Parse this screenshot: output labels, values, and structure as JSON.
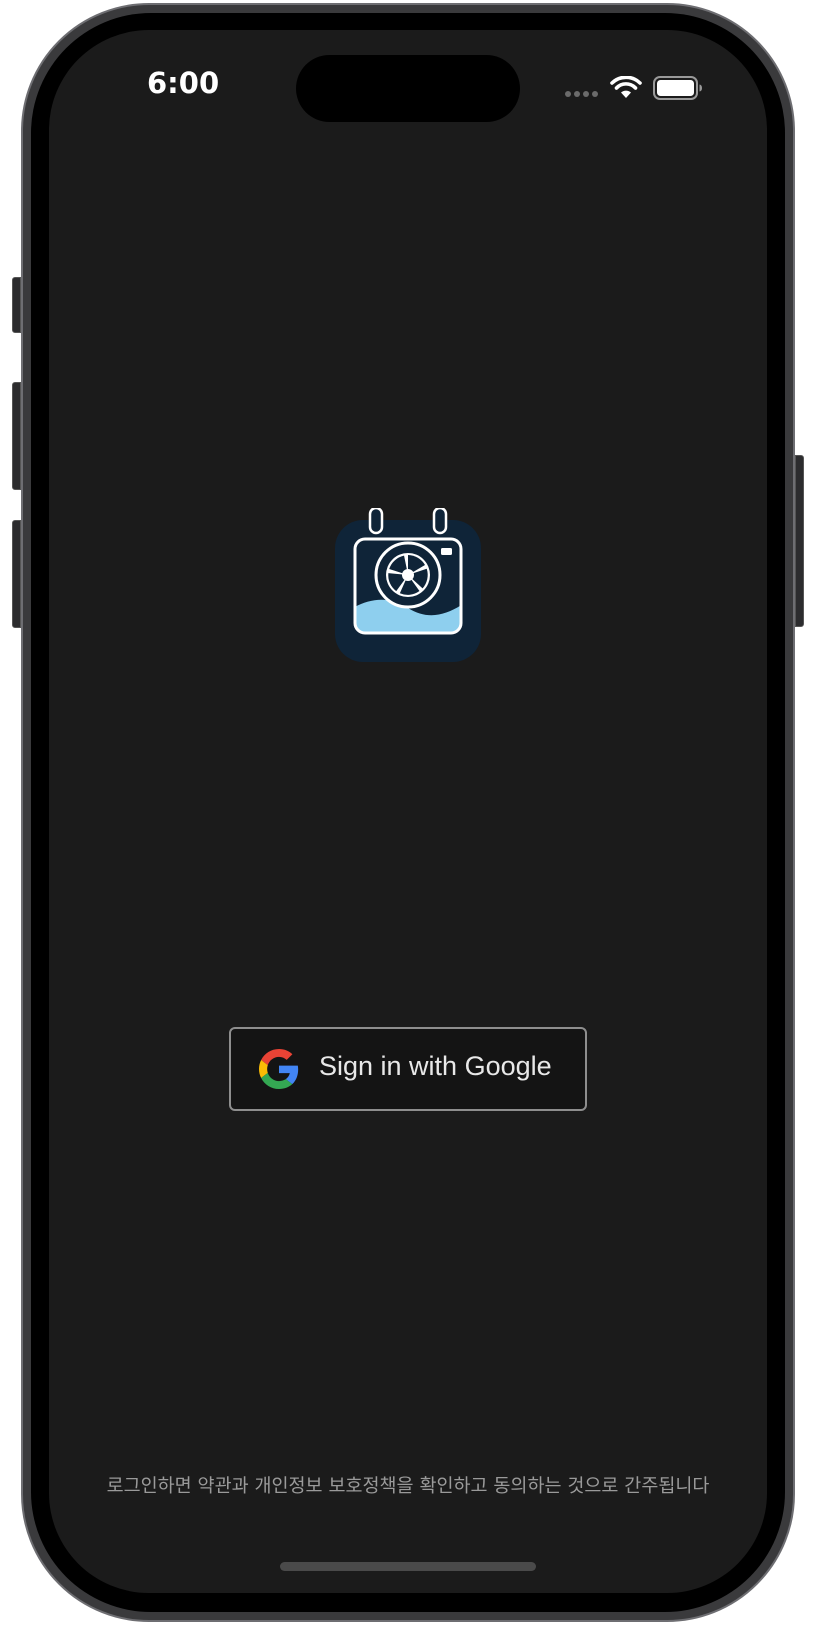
{
  "status_bar": {
    "time": "6:00",
    "icons": [
      "signal-dots-icon",
      "wifi-icon",
      "battery-icon"
    ]
  },
  "app": {
    "logo_icon": "calendar-camera-logo-icon",
    "colors": {
      "background": "#1b1b1b",
      "logo_bg": "#0f2438",
      "logo_wave": "#8ecfee",
      "button_border": "#8e8e8e",
      "button_text": "#e8e8e8"
    }
  },
  "login": {
    "google_button_label": "Sign in with Google",
    "google_icon": "google-g-icon"
  },
  "footer": {
    "terms_text": "로그인하면 약관과 개인정보 보호정책을 확인하고 동의하는 것으로 간주됩니다"
  }
}
